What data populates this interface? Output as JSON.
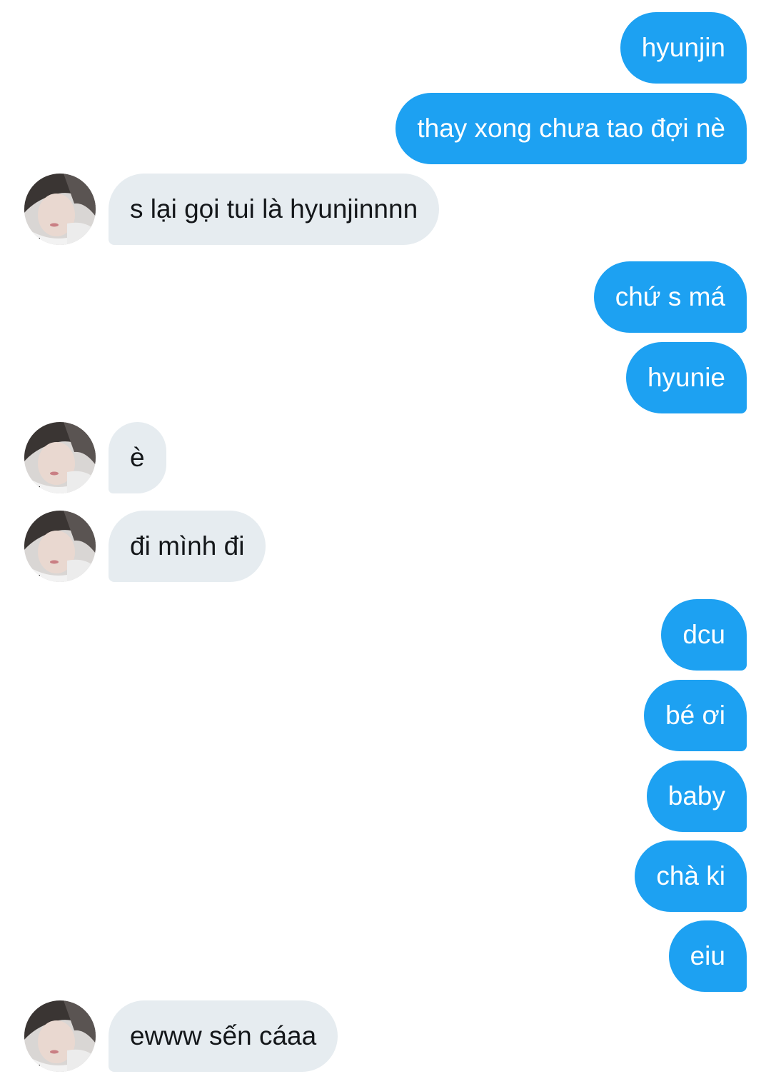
{
  "conversation": {
    "messages": [
      {
        "from": "me",
        "text": "hyunjin"
      },
      {
        "from": "me",
        "text": "thay xong chưa tao đợi nè"
      },
      {
        "from": "them",
        "text": "s lại gọi tui là hyunjinnnn"
      },
      {
        "from": "me",
        "text": "chứ s má"
      },
      {
        "from": "me",
        "text": "hyunie"
      },
      {
        "from": "them",
        "text": "è"
      },
      {
        "from": "them",
        "text": "đi mình đi"
      },
      {
        "from": "me",
        "text": "dcu"
      },
      {
        "from": "me",
        "text": "bé ơi"
      },
      {
        "from": "me",
        "text": "baby"
      },
      {
        "from": "me",
        "text": "chà ki"
      },
      {
        "from": "me",
        "text": "eiu"
      },
      {
        "from": "them",
        "text": "ewww sến cáaa"
      }
    ]
  },
  "colors": {
    "sent_bubble": "#1da1f2",
    "received_bubble": "#e6ecf0",
    "received_text": "#14171a",
    "background": "#ffffff"
  },
  "icons": {
    "avatar": "profile-photo-avatar"
  }
}
